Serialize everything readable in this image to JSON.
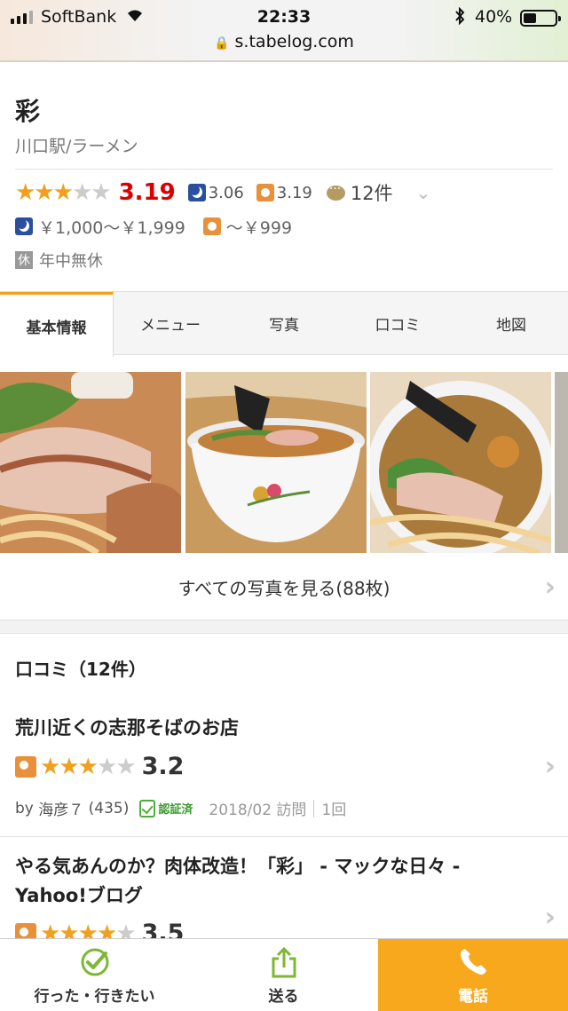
{
  "status_bar": {
    "carrier": "SoftBank",
    "time": "22:33",
    "battery": "40%",
    "battery_level": 0.4,
    "url": "s.tabelog.com"
  },
  "shop": {
    "name": "彩",
    "genre": "川口駅/ラーメン",
    "rating": "3.19",
    "rating_value": 3.19,
    "dinner_rating": "3.06",
    "lunch_rating": "3.19",
    "review_count": "12件",
    "dinner_budget": "￥1,000～￥1,999",
    "lunch_budget": "～￥999",
    "holiday_badge": "休",
    "holiday": "年中無休"
  },
  "tabs": [
    {
      "label": "基本情報",
      "active": true
    },
    {
      "label": "メニュー",
      "active": false
    },
    {
      "label": "写真",
      "active": false
    },
    {
      "label": "口コミ",
      "active": false
    },
    {
      "label": "地図",
      "active": false
    }
  ],
  "photos": {
    "see_all": "すべての写真を見る(88枚)"
  },
  "reviews": {
    "heading": "口コミ（12件）",
    "items": [
      {
        "title": "荒川近くの志那そばのお店",
        "score": "3.2",
        "score_value": 3.2,
        "reviewer_prefix": "by",
        "reviewer": "海彦７",
        "reviewer_count": "(435)",
        "verified": "認証済",
        "visit_date": "2018/02 訪問",
        "visit_count": "1回"
      },
      {
        "title": "やる気あんのか？肉体改造！「彩」 - マックな日々 - Yahoo!ブログ",
        "score": "3.5",
        "score_value": 3.5
      }
    ]
  },
  "bottom_bar": {
    "went": "行った・行きたい",
    "send": "送る",
    "call": "電話"
  },
  "colors": {
    "accent": "#f7a81c",
    "rating_red": "#dd0000",
    "star": "#f0a01e",
    "dinner": "#2a4f9c",
    "lunch": "#e8913a"
  }
}
